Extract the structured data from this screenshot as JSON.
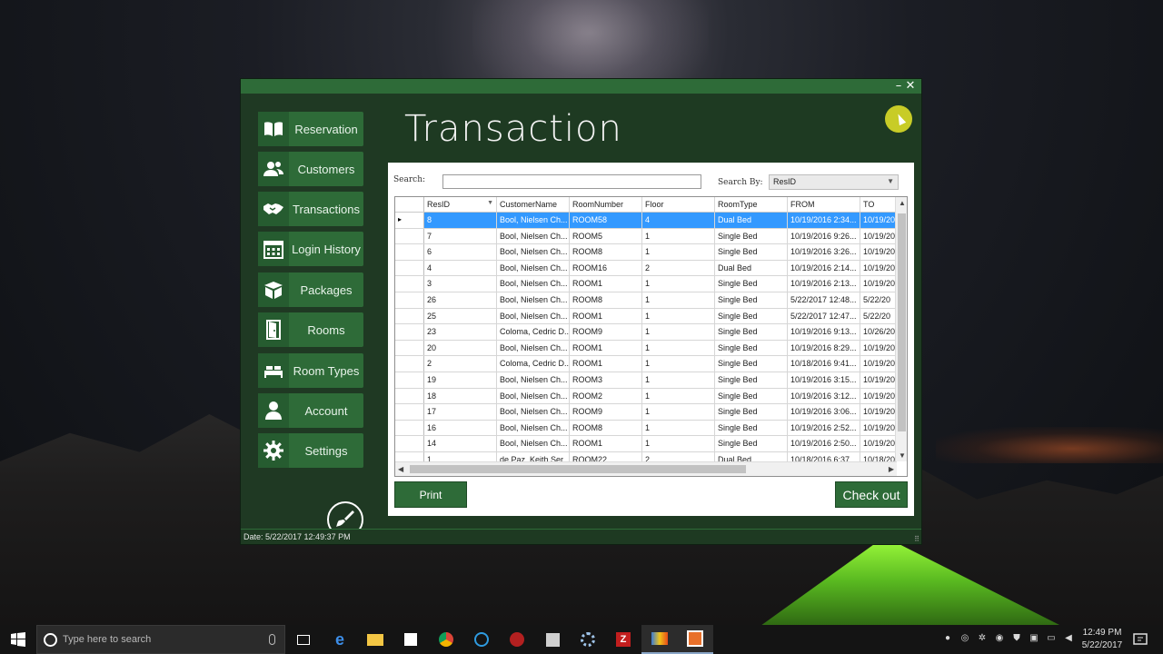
{
  "window": {
    "minimize_glyph": "–",
    "close_glyph": "✕"
  },
  "sidebar": {
    "items": [
      {
        "label": "Reservation",
        "icon": "book-icon"
      },
      {
        "label": "Customers",
        "icon": "users-icon"
      },
      {
        "label": "Transactions",
        "icon": "handshake-icon"
      },
      {
        "label": "Login History",
        "icon": "calendar-icon"
      },
      {
        "label": "Packages",
        "icon": "box-icon"
      },
      {
        "label": "Rooms",
        "icon": "door-icon"
      },
      {
        "label": "Room Types",
        "icon": "bed-icon"
      },
      {
        "label": "Account",
        "icon": "person-icon"
      },
      {
        "label": "Settings",
        "icon": "gear-icon"
      }
    ]
  },
  "header": {
    "title": "Transaction"
  },
  "search": {
    "label": "Search:",
    "value": "",
    "by_label": "Search By:",
    "by_value": "ResID"
  },
  "grid": {
    "columns": [
      "ResID",
      "CustomerName",
      "RoomNumber",
      "Floor",
      "RoomType",
      "FROM",
      "TO"
    ],
    "rows": [
      [
        "8",
        "Bool, Nielsen Ch...",
        "ROOM58",
        "4",
        "Dual Bed",
        "10/19/2016 2:34...",
        "10/19/20"
      ],
      [
        "7",
        "Bool, Nielsen Ch...",
        "ROOM5",
        "1",
        "Single Bed",
        "10/19/2016 9:26...",
        "10/19/20"
      ],
      [
        "6",
        "Bool, Nielsen Ch...",
        "ROOM8",
        "1",
        "Single Bed",
        "10/19/2016 3:26...",
        "10/19/20"
      ],
      [
        "4",
        "Bool, Nielsen Ch...",
        "ROOM16",
        "2",
        "Dual Bed",
        "10/19/2016 2:14...",
        "10/19/20"
      ],
      [
        "3",
        "Bool, Nielsen Ch...",
        "ROOM1",
        "1",
        "Single Bed",
        "10/19/2016 2:13...",
        "10/19/20"
      ],
      [
        "26",
        "Bool, Nielsen Ch...",
        "ROOM8",
        "1",
        "Single Bed",
        "5/22/2017 12:48...",
        "5/22/20"
      ],
      [
        "25",
        "Bool, Nielsen Ch...",
        "ROOM1",
        "1",
        "Single Bed",
        "5/22/2017 12:47...",
        "5/22/20"
      ],
      [
        "23",
        "Coloma, Cedric D...",
        "ROOM9",
        "1",
        "Single Bed",
        "10/19/2016 9:13...",
        "10/26/20"
      ],
      [
        "20",
        "Bool, Nielsen Ch...",
        "ROOM1",
        "1",
        "Single Bed",
        "10/19/2016 8:29...",
        "10/19/20"
      ],
      [
        "2",
        "Coloma, Cedric D...",
        "ROOM1",
        "1",
        "Single Bed",
        "10/18/2016 9:41...",
        "10/19/20"
      ],
      [
        "19",
        "Bool, Nielsen Ch...",
        "ROOM3",
        "1",
        "Single Bed",
        "10/19/2016 3:15...",
        "10/19/20"
      ],
      [
        "18",
        "Bool, Nielsen Ch...",
        "ROOM2",
        "1",
        "Single Bed",
        "10/19/2016 3:12...",
        "10/19/20"
      ],
      [
        "17",
        "Bool, Nielsen Ch...",
        "ROOM9",
        "1",
        "Single Bed",
        "10/19/2016 3:06...",
        "10/19/20"
      ],
      [
        "16",
        "Bool, Nielsen Ch...",
        "ROOM8",
        "1",
        "Single Bed",
        "10/19/2016 2:52...",
        "10/19/20"
      ],
      [
        "14",
        "Bool, Nielsen Ch...",
        "ROOM1",
        "1",
        "Single Bed",
        "10/19/2016 2:50...",
        "10/19/20"
      ],
      [
        "1",
        "de Paz, Keith Ser...",
        "ROOM22",
        "2",
        "Dual Bed",
        "10/18/2016 6:37...",
        "10/18/20"
      ]
    ],
    "selected_row": 0
  },
  "actions": {
    "print_label": "Print",
    "checkout_label": "Check out"
  },
  "status": {
    "text": "Date: 5/22/2017 12:49:37 PM"
  },
  "taskbar": {
    "search_placeholder": "Type here to search",
    "time": "12:49 PM",
    "date": "5/22/2017"
  },
  "colors": {
    "accent": "#2e6b38",
    "window_bg": "#1e3a22",
    "selection": "#3399ff"
  }
}
